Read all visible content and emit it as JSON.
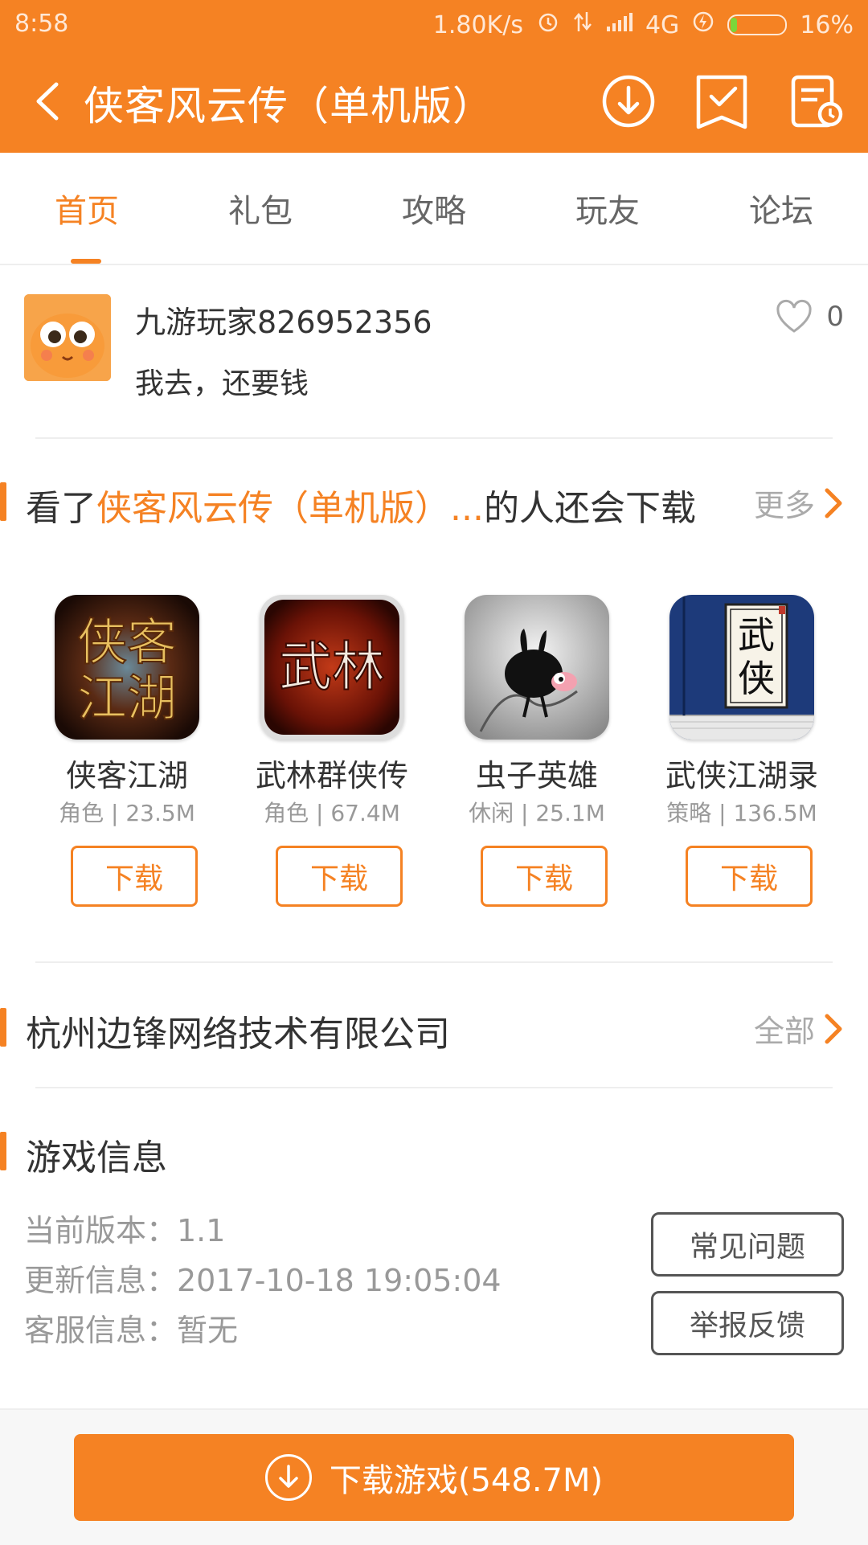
{
  "status": {
    "time": "8:58",
    "speed": "1.80K/s",
    "network": "4G",
    "battery": "16%"
  },
  "appbar": {
    "title": "侠客风云传（单机版）",
    "icons": [
      "back-icon",
      "download-icon",
      "checklist-icon",
      "history-icon"
    ]
  },
  "tabs": [
    "首页",
    "礼包",
    "攻略",
    "玩友",
    "论坛"
  ],
  "comment": {
    "username": "九游玩家826952356",
    "text": "我去，还要钱",
    "likes": "0"
  },
  "recommend": {
    "title_prefix": "看了",
    "title_game": "侠客风云传（单机版）...",
    "title_suffix": "的人还会下载",
    "more_label": "更多",
    "games": [
      {
        "name": "侠客江湖",
        "meta": "角色 | 23.5M",
        "button": "下载",
        "icon_text": "侠客江湖"
      },
      {
        "name": "武林群侠传",
        "meta": "角色 | 67.4M",
        "button": "下载",
        "icon_text": "武林"
      },
      {
        "name": "虫子英雄",
        "meta": "休闲 | 25.1M",
        "button": "下载",
        "icon_text": ""
      },
      {
        "name": "武侠江湖录",
        "meta": "策略 | 136.5M",
        "button": "下载",
        "icon_text": "武侠"
      }
    ]
  },
  "developer": {
    "name": "杭州边锋网络技术有限公司",
    "all_label": "全部"
  },
  "game_info": {
    "heading": "游戏信息",
    "version": "当前版本：1.1",
    "updated": "更新信息：2017-10-18 19:05:04",
    "support": "客服信息：暂无",
    "faq_button": "常见问题",
    "report_button": "举报反馈"
  },
  "bottom": {
    "download_label": "下载游戏(548.7M)"
  },
  "colors": {
    "accent": "#f58223",
    "text": "#333333",
    "muted": "#999999"
  }
}
